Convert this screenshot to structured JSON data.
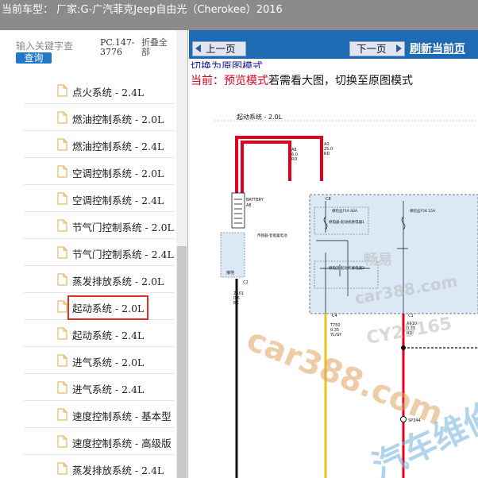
{
  "header": {
    "vehicle": "当前车型：  厂家:G-广汽菲克Jeep自由光（Cherokee）2016"
  },
  "sidebar": {
    "search_placeholder": "输入关键字查",
    "search_button": "查询",
    "code": "PC.147-3776",
    "collapse_all": "折叠全部",
    "items": [
      {
        "label": "点火系统 - 2.4L"
      },
      {
        "label": "燃油控制系统 - 2.0L"
      },
      {
        "label": "燃油控制系统 - 2.4L"
      },
      {
        "label": "空调控制系统 - 2.0L"
      },
      {
        "label": "空调控制系统 - 2.4L"
      },
      {
        "label": "节气门控制系统 - 2.0L"
      },
      {
        "label": "节气门控制系统 - 2.4L"
      },
      {
        "label": "蒸发排放系统 - 2.0L"
      },
      {
        "label": "起动系统 - 2.0L",
        "selected": true
      },
      {
        "label": "起动系统 - 2.4L"
      },
      {
        "label": "进气系统 - 2.0L"
      },
      {
        "label": "进气系统 - 2.4L"
      },
      {
        "label": "速度控制系统 - 基本型"
      },
      {
        "label": "速度控制系统 - 高级版"
      },
      {
        "label": "蒸发排放系统 - 2.4L"
      }
    ]
  },
  "toolbar": {
    "prev_label": "上一页",
    "next_label": "下一页",
    "refresh_label": "刷新当前页"
  },
  "mode": {
    "switch_link": "切换为原图模式",
    "current_prefix": "当前：",
    "current_mode": "预览模式",
    "hint": "若需看大图，切换至原图模式"
  },
  "diagram": {
    "title": "起动系统 - 2.0L",
    "watermark_1": "畅易",
    "watermark_2": "car388.com",
    "watermark_3": "CY29165",
    "watermark_4": "car388.com",
    "watermark_5": "汽车维修",
    "label_a8": "A8",
    "label_a8_gauge": "6.0",
    "label_a8_color": "RD",
    "label_a0": "A0",
    "label_a0_gauge": "25.0",
    "label_a0_color": "RD",
    "battery": "BATTERY",
    "battery_sub": "A8",
    "sensor": "传感器-智能蓄电池",
    "ground": "接地",
    "ground_code": "Z501",
    "ground_gauge": "0.5",
    "ground_color": "BK",
    "fuse1": "保险丝F19 40A",
    "fuse2": "保险丝F56 15A",
    "relay1": "继电器-起动机继电器1",
    "relay2": "继电器-起动机继电器2",
    "wire_t750": "T750",
    "wire_t750_gauge": "0.35",
    "wire_t750_color": "YL/GY",
    "wire_a910": "A910",
    "wire_a910_gauge": "0.75",
    "wire_a910_color": "RD",
    "splice": "SP344",
    "conn_c2": "C2",
    "conn_c8": "C8",
    "conn_c4": "C4",
    "conn_c1": "C1"
  },
  "colors": {
    "wire_red": "#e3001b",
    "wire_black": "#111111",
    "module_fill": "#dbe9f6",
    "accent": "#1f6bb3"
  }
}
